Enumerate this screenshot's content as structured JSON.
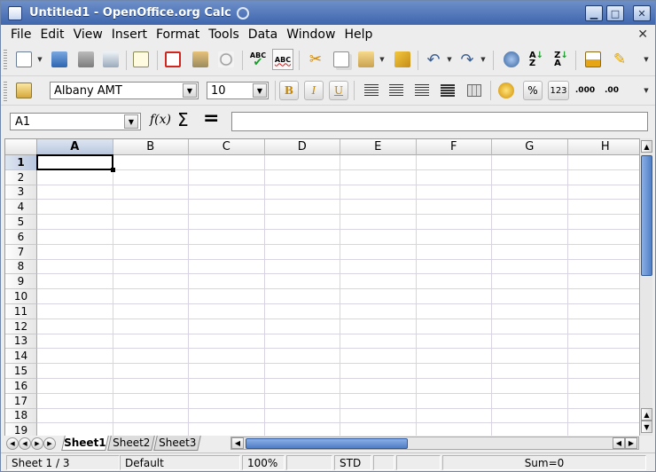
{
  "window": {
    "title": "Untitled1 - OpenOffice.org Calc"
  },
  "menubar": {
    "items": [
      "File",
      "Edit",
      "View",
      "Insert",
      "Format",
      "Tools",
      "Data",
      "Window",
      "Help"
    ]
  },
  "toolbar_standard": {
    "icons": [
      "new-document-icon",
      "open-folder-icon",
      "save-icon",
      "email-icon",
      "edit-file-icon",
      "pdf-export-icon",
      "print-icon",
      "page-preview-icon",
      "spellcheck-icon",
      "autospellcheck-icon",
      "cut-icon",
      "copy-icon",
      "paste-icon",
      "format-paintbrush-icon",
      "undo-icon",
      "redo-icon",
      "navigator-icon",
      "sort-ascending-icon",
      "sort-descending-icon",
      "chart-icon",
      "draw-functions-icon"
    ],
    "spellcheck_label": "ABC",
    "autospell_label": "ABC"
  },
  "toolbar_formatting": {
    "font_name": "Albany AMT",
    "font_size": "10",
    "bold_label": "B",
    "italic_label": "I",
    "underline_label": "U",
    "percent_label": "%",
    "number_label": "123",
    "add_decimal_label": ".000",
    "delete_decimal_label": ".00"
  },
  "formulabar": {
    "cell_ref": "A1",
    "formula": ""
  },
  "grid": {
    "columns": [
      "A",
      "B",
      "C",
      "D",
      "E",
      "F",
      "G",
      "H"
    ],
    "rows": [
      "1",
      "2",
      "3",
      "4",
      "5",
      "6",
      "7",
      "8",
      "9",
      "10",
      "11",
      "12",
      "13",
      "14",
      "15",
      "16",
      "17",
      "18",
      "19"
    ],
    "selected_column": "A",
    "selected_row": "1"
  },
  "sheets": {
    "tabs": [
      "Sheet1",
      "Sheet2",
      "Sheet3"
    ],
    "active": "Sheet1"
  },
  "statusbar": {
    "sheet_pos": "Sheet 1 / 3",
    "page_style": "Default",
    "zoom": "100%",
    "selection_mode": "STD",
    "sum": "Sum=0"
  },
  "colors": {
    "selection": "#b8c7df",
    "titlebar": "#4a70b4",
    "scroll_thumb": "#4f7ec4"
  }
}
